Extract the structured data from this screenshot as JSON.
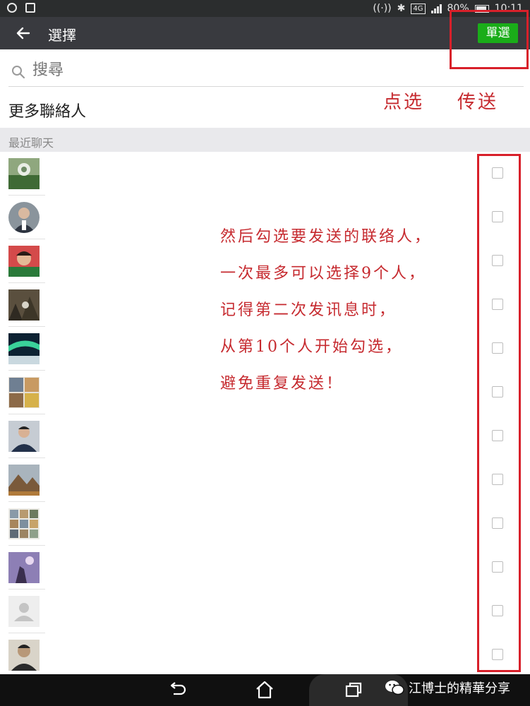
{
  "status_bar": {
    "signal_type": "4G",
    "battery": "80%",
    "time": "10:11",
    "icons": [
      "hotspot-icon",
      "image-icon",
      "wifi-icon",
      "bluetooth-icon",
      "signal-icon",
      "battery-icon"
    ]
  },
  "header": {
    "back_icon": "arrow-left-icon",
    "title": "選擇",
    "single_select_label": "單選"
  },
  "search": {
    "placeholder": "搜尋",
    "icon": "search-icon"
  },
  "more_contacts_label": "更多聯絡人",
  "section_label": "最近聊天",
  "contacts": [
    {
      "avatar": "landscape-photo",
      "checked": false
    },
    {
      "avatar": "person-photo",
      "checked": false
    },
    {
      "avatar": "person-photo",
      "checked": false
    },
    {
      "avatar": "nature-photo",
      "checked": false
    },
    {
      "avatar": "aurora-photo",
      "checked": false
    },
    {
      "avatar": "collage-photo",
      "checked": false
    },
    {
      "avatar": "person-photo",
      "checked": false
    },
    {
      "avatar": "mountain-photo",
      "checked": false
    },
    {
      "avatar": "collage-photo",
      "checked": false
    },
    {
      "avatar": "purple-photo",
      "checked": false
    },
    {
      "avatar": "default-avatar",
      "checked": false
    },
    {
      "avatar": "person-photo",
      "checked": false
    }
  ],
  "annotations": {
    "tap_label": "点选",
    "send_label": "传送",
    "instructions": [
      "然后勾选要发送的联络人，",
      "一次最多可以选择9个人，",
      "记得第二次发讯息时，",
      "从第10个人开始勾选，",
      "避免重复发送！"
    ],
    "highlight_color": "#d8202a"
  },
  "nav_bar": {
    "buttons": [
      "back-icon",
      "home-icon",
      "recent-apps-icon"
    ]
  },
  "watermark": {
    "icon": "wechat-icon",
    "text": "江博士的精華分享"
  },
  "colors": {
    "header_bg": "#393a3f",
    "accent_green": "#1aad19",
    "annotation_red": "#c62a2f"
  }
}
